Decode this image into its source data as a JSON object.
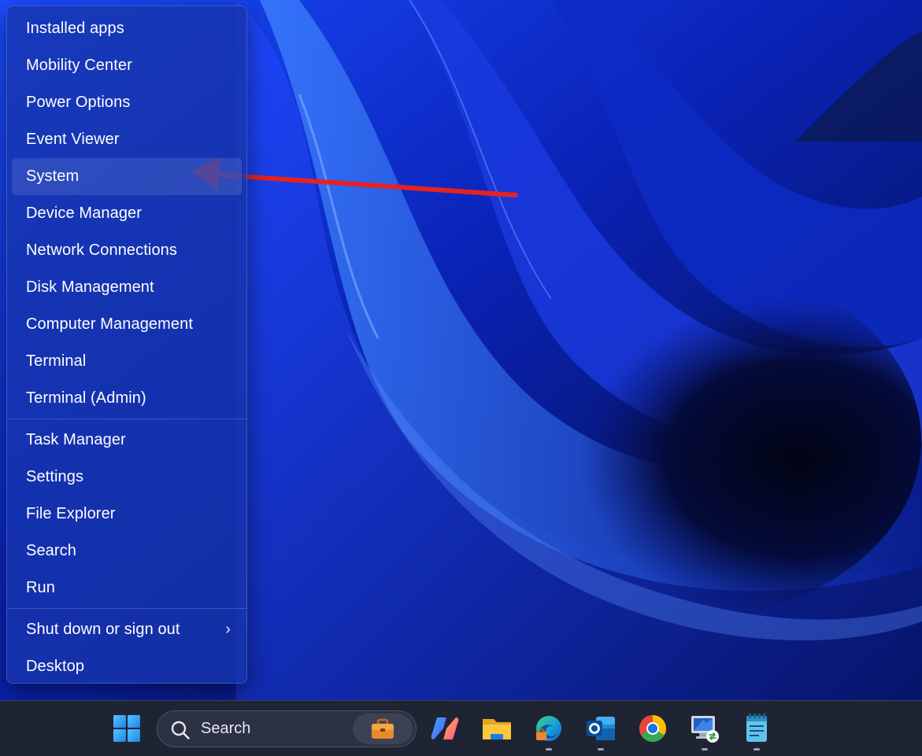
{
  "menu": {
    "group1": [
      {
        "label": "Installed apps"
      },
      {
        "label": "Mobility Center"
      },
      {
        "label": "Power Options"
      },
      {
        "label": "Event Viewer"
      },
      {
        "label": "System"
      },
      {
        "label": "Device Manager"
      },
      {
        "label": "Network Connections"
      },
      {
        "label": "Disk Management"
      },
      {
        "label": "Computer Management"
      },
      {
        "label": "Terminal"
      },
      {
        "label": "Terminal (Admin)"
      }
    ],
    "group2": [
      {
        "label": "Task Manager"
      },
      {
        "label": "Settings"
      },
      {
        "label": "File Explorer"
      },
      {
        "label": "Search"
      },
      {
        "label": "Run"
      }
    ],
    "group3": [
      {
        "label": "Shut down or sign out",
        "submenu_glyph": "›"
      },
      {
        "label": "Desktop"
      }
    ],
    "highlighted": "System"
  },
  "taskbar": {
    "search_placeholder": "Search",
    "icons": [
      "windows-start-icon",
      "search-icon",
      "work-briefcase-icon",
      "copilot-icon",
      "file-explorer-icon",
      "edge-icon",
      "outlook-icon",
      "chrome-icon",
      "remote-desktop-icon",
      "notepad-icon"
    ]
  },
  "colors": {
    "menu_bg": "#1634aa",
    "taskbar_bg": "#1f2433",
    "annotation_arrow": "#e52222"
  }
}
